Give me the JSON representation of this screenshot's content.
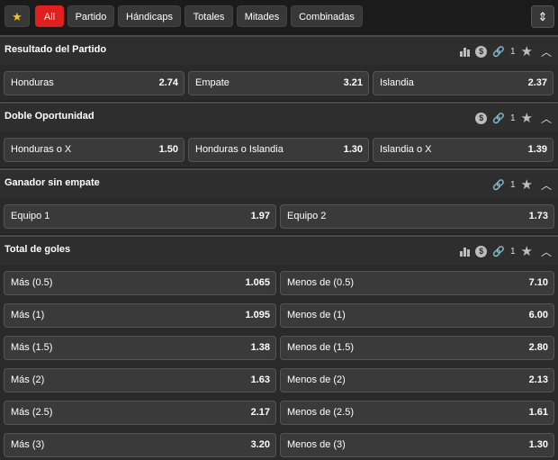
{
  "filters": {
    "favorites_icon": "star-icon",
    "items": [
      "All",
      "Partido",
      "Hándicaps",
      "Totales",
      "Mitades",
      "Combinadas"
    ],
    "active": "All",
    "collapse_icon": "collapse-all-icon"
  },
  "sections": [
    {
      "title": "Resultado del Partido",
      "icons": {
        "stats": true,
        "cashout": "$",
        "links": "1",
        "favorite": true
      },
      "odds": [
        {
          "label": "Honduras",
          "value": "2.74"
        },
        {
          "label": "Empate",
          "value": "3.21"
        },
        {
          "label": "Islandia",
          "value": "2.37"
        }
      ]
    },
    {
      "title": "Doble Oportunidad",
      "icons": {
        "stats": false,
        "cashout": "$",
        "links": "1",
        "favorite": true
      },
      "odds": [
        {
          "label": "Honduras o X",
          "value": "1.50"
        },
        {
          "label": "Honduras o Islandia",
          "value": "1.30"
        },
        {
          "label": "Islandia o X",
          "value": "1.39"
        }
      ]
    },
    {
      "title": "Ganador sin empate",
      "icons": {
        "stats": false,
        "cashout": "",
        "links": "1",
        "favorite": true
      },
      "odds": [
        {
          "label": "Equipo 1",
          "value": "1.97"
        },
        {
          "label": "Equipo 2",
          "value": "1.73"
        }
      ]
    },
    {
      "title": "Total de goles",
      "icons": {
        "stats": true,
        "cashout": "$",
        "links": "1",
        "favorite": true
      },
      "rows": [
        [
          {
            "label": "Más (0.5)",
            "value": "1.065"
          },
          {
            "label": "Menos de (0.5)",
            "value": "7.10"
          }
        ],
        [
          {
            "label": "Más (1)",
            "value": "1.095"
          },
          {
            "label": "Menos de (1)",
            "value": "6.00"
          }
        ],
        [
          {
            "label": "Más (1.5)",
            "value": "1.38"
          },
          {
            "label": "Menos de (1.5)",
            "value": "2.80"
          }
        ],
        [
          {
            "label": "Más (2)",
            "value": "1.63"
          },
          {
            "label": "Menos de (2)",
            "value": "2.13"
          }
        ],
        [
          {
            "label": "Más (2.5)",
            "value": "2.17"
          },
          {
            "label": "Menos de (2.5)",
            "value": "1.61"
          }
        ],
        [
          {
            "label": "Más (3)",
            "value": "3.20"
          },
          {
            "label": "Menos de (3)",
            "value": "1.30"
          }
        ]
      ]
    }
  ]
}
